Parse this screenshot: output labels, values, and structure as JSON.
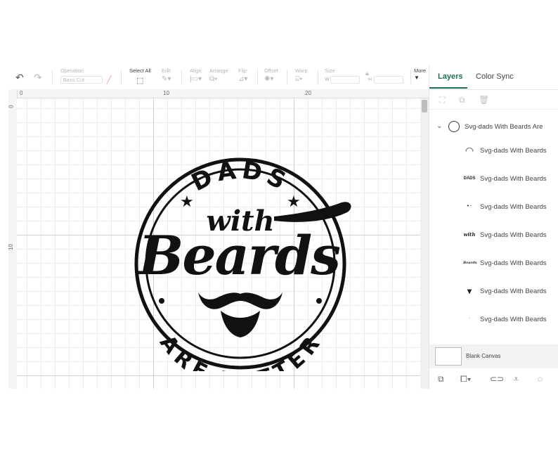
{
  "toolbar": {
    "undo_icon": "undo-icon",
    "redo_icon": "redo-icon",
    "operation_label": "Operation",
    "operation_value": "Basic Cut",
    "select_all_label": "Select All",
    "edit_label": "Edit",
    "align_label": "Align",
    "arrange_label": "Arrange",
    "flip_label": "Flip",
    "offset_label": "Offset",
    "warp_label": "Warp",
    "size_label": "Size",
    "w_label": "W",
    "h_label": "H",
    "more_label": "More"
  },
  "rulers": {
    "top": [
      "0",
      "10",
      "20"
    ],
    "left": [
      "0",
      "10"
    ]
  },
  "design": {
    "top_text": "DADS",
    "with_text": "with",
    "main_text": "Beards",
    "bottom_text": "ARE BETTER",
    "ink_color": "#111111"
  },
  "panel": {
    "tabs": [
      {
        "label": "Layers"
      },
      {
        "label": "Color Sync"
      }
    ],
    "active_color": "#1f6f52",
    "group_name": "Svg-dads With Beards Are",
    "layers": [
      {
        "thumb": "◠",
        "name": "Svg-dads With Beards"
      },
      {
        "thumb": "DADS",
        "name": "Svg-dads With Beards"
      },
      {
        "thumb": "• ·",
        "name": "Svg-dads With Beards"
      },
      {
        "thumb": "with",
        "name": "Svg-dads With Beards"
      },
      {
        "thumb": "Beards",
        "name": "Svg-dads With Beards"
      },
      {
        "thumb": "▾",
        "name": "Svg-dads With Beards"
      },
      {
        "thumb": "·",
        "name": "Svg-dads With Beards"
      }
    ],
    "blank_canvas_label": "Blank Canvas"
  }
}
